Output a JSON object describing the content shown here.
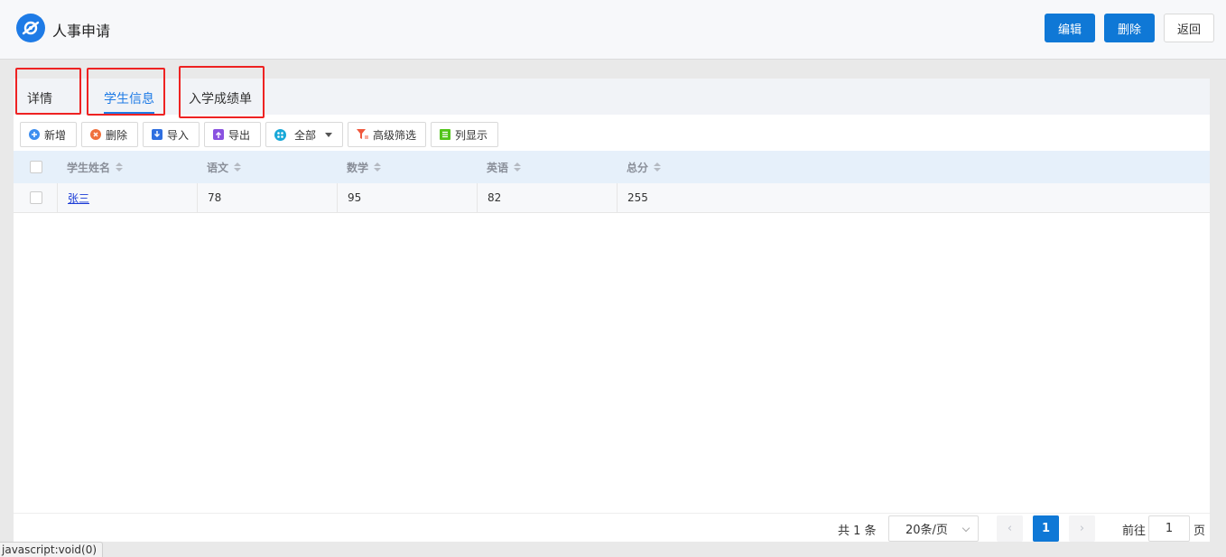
{
  "header": {
    "title": "人事申请",
    "edit_label": "编辑",
    "delete_label": "删除",
    "back_label": "返回",
    "accent_color": "#0f78d6"
  },
  "tabs": [
    {
      "label": "详情",
      "active": false
    },
    {
      "label": "学生信息",
      "active": true
    },
    {
      "label": "入学成绩单",
      "active": false
    }
  ],
  "toolbar": {
    "add_label": "新增",
    "delete_label": "删除",
    "import_label": "导入",
    "export_label": "导出",
    "scope_label": "全部",
    "filter_label": "高级筛选",
    "columns_label": "列显示"
  },
  "table": {
    "columns": [
      "学生姓名",
      "语文",
      "数学",
      "英语",
      "总分"
    ],
    "rows": [
      {
        "name": "张三",
        "chinese": "78",
        "math": "95",
        "english": "82",
        "total": "255"
      }
    ]
  },
  "pagination": {
    "total_text": "共 1 条",
    "page_size": "20条/页",
    "current_page": "1",
    "goto_label": "前往",
    "goto_value": "1",
    "goto_suffix": "页"
  },
  "status_bar": "javascript:void(0)"
}
